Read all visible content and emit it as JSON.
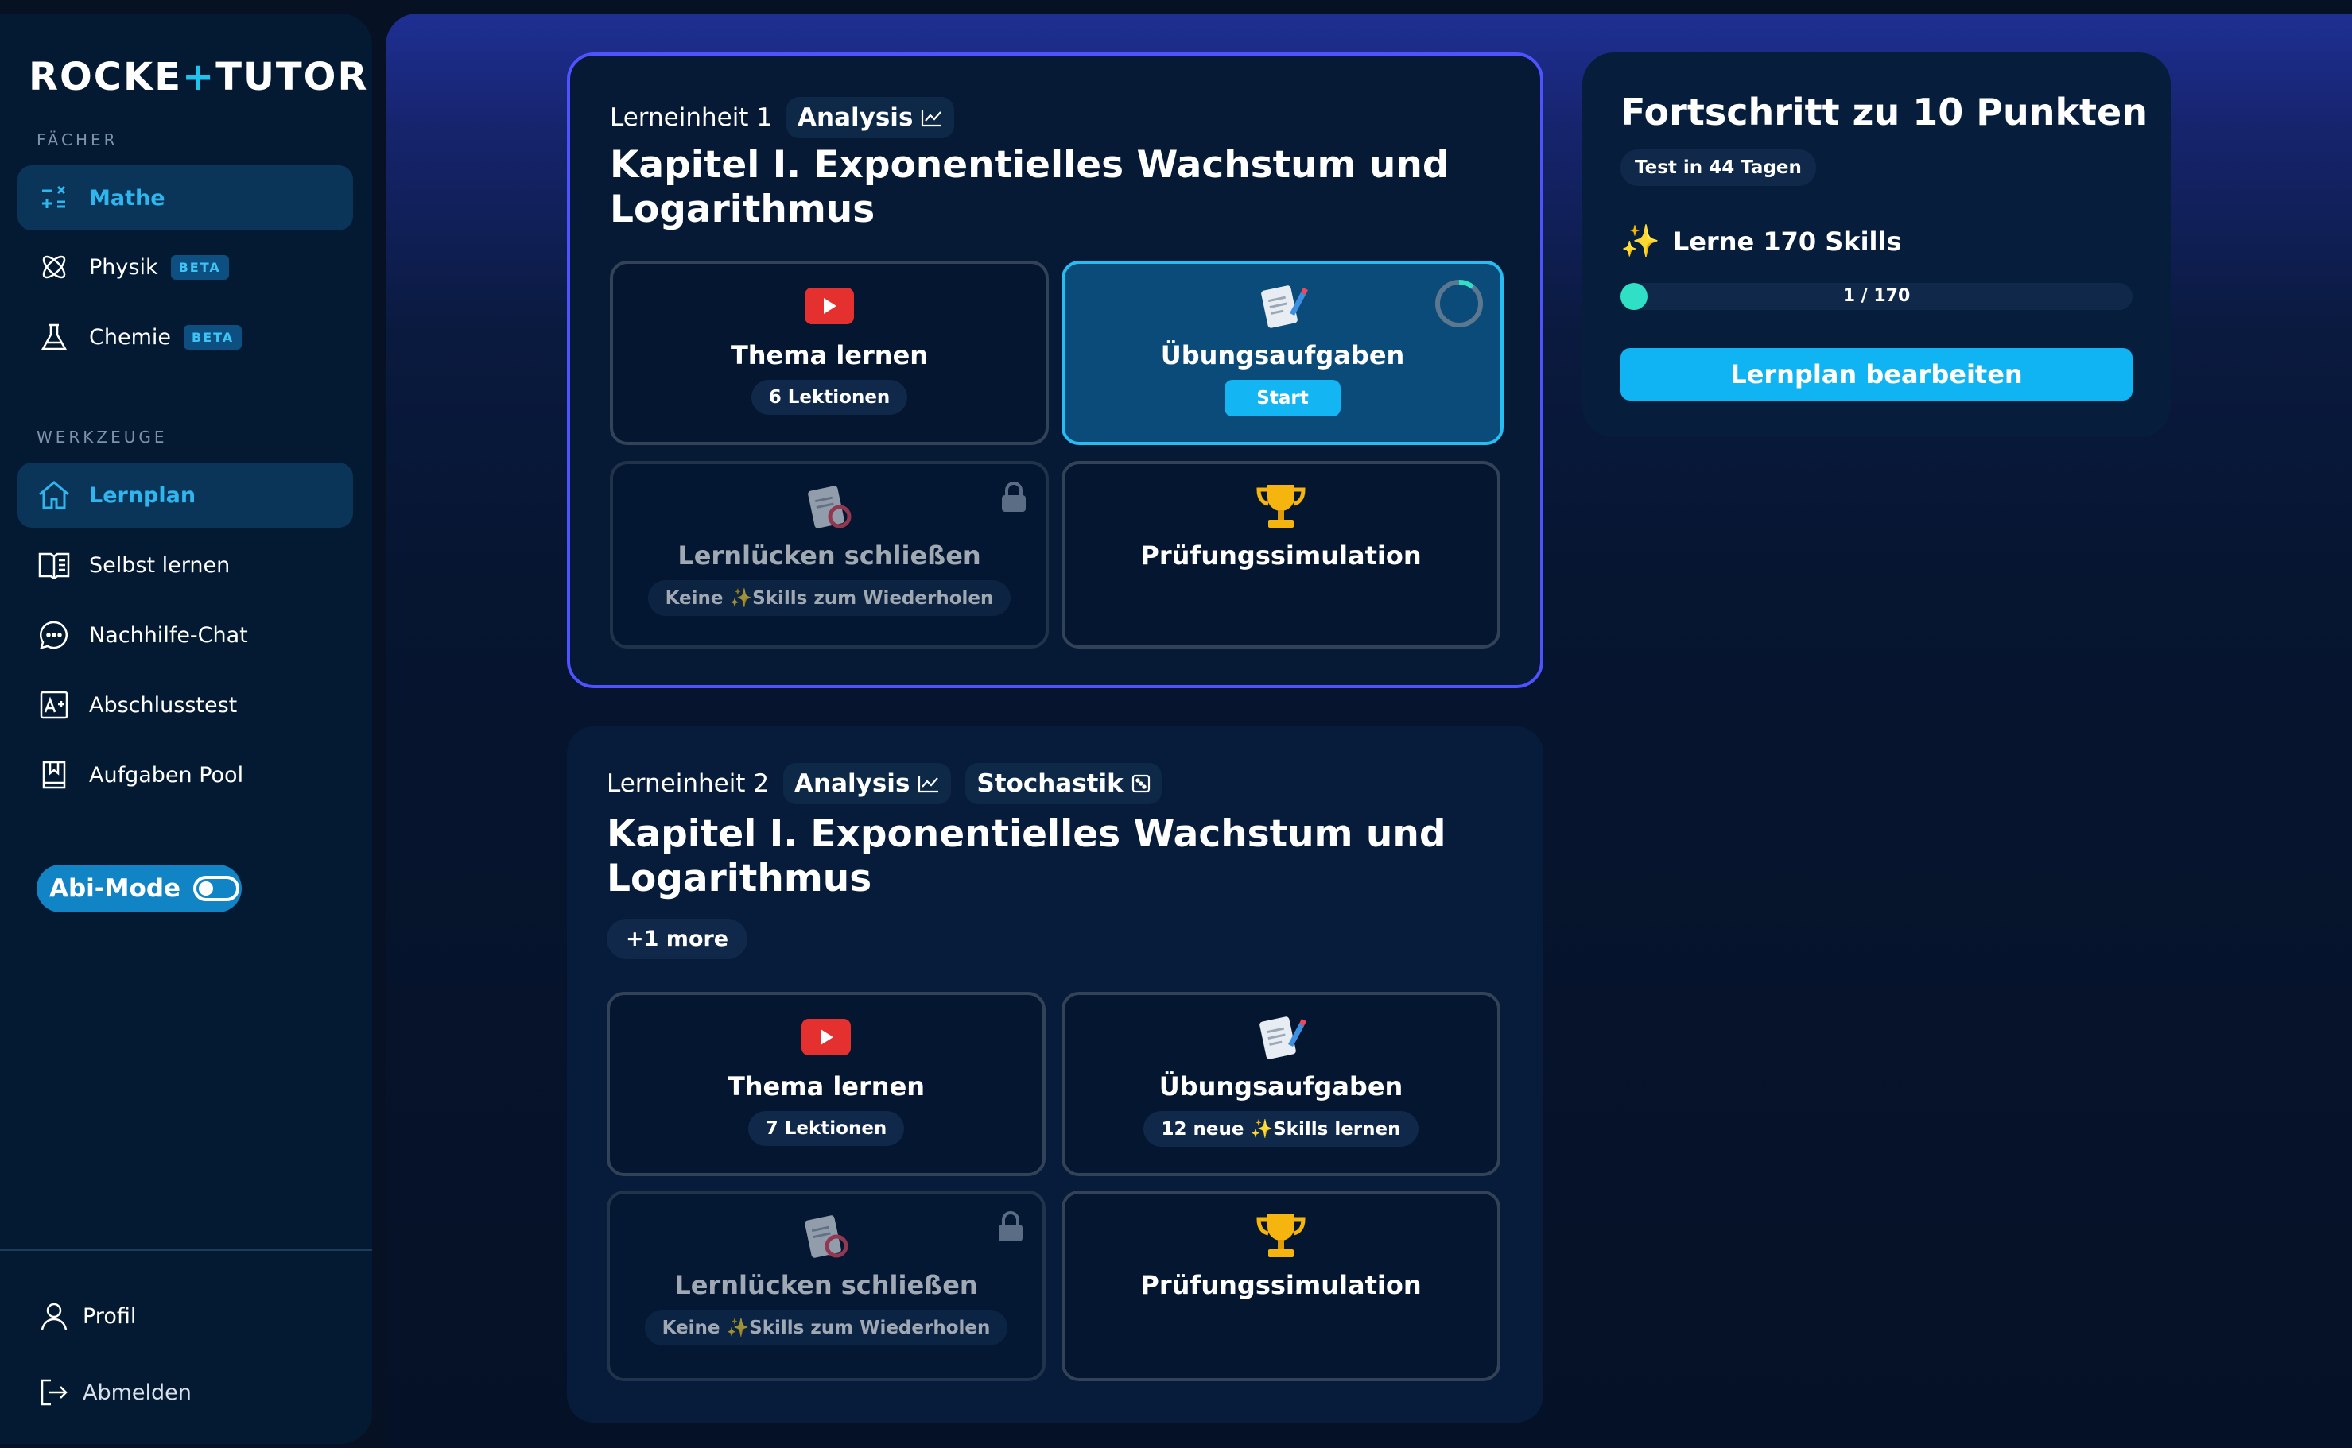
{
  "brand": {
    "logo_left": "ROCKE",
    "logo_plus": "+",
    "logo_right": "TUTOR"
  },
  "sidebar": {
    "subjects_label": "FÄCHER",
    "subjects": [
      {
        "label": "Mathe",
        "active": true
      },
      {
        "label": "Physik",
        "badge": "BETA"
      },
      {
        "label": "Chemie",
        "badge": "BETA"
      }
    ],
    "tools_label": "WERKZEUGE",
    "tools": [
      {
        "label": "Lernplan",
        "active": true
      },
      {
        "label": "Selbst lernen"
      },
      {
        "label": "Nachhilfe-Chat"
      },
      {
        "label": "Abschlusstest"
      },
      {
        "label": "Aufgaben Pool"
      }
    ],
    "abi_mode_label": "Abi-Mode",
    "profile_label": "Profil",
    "logout_label": "Abmelden"
  },
  "units": [
    {
      "unit_label": "Lerneinheit 1",
      "tags": [
        "Analysis"
      ],
      "title": "Kapitel I. Exponentielles Wachstum und Logarithmus",
      "tiles": [
        {
          "title": "Thema lernen",
          "pill": "6 Lektionen"
        },
        {
          "title": "Übungsaufgaben",
          "button": "Start"
        },
        {
          "title": "Lernlücken schließen",
          "pill_a": "Keine",
          "pill_b": "Skills zum Wiederholen"
        },
        {
          "title": "Prüfungssimulation"
        }
      ]
    },
    {
      "unit_label": "Lerneinheit 2",
      "tags": [
        "Analysis",
        "Stochastik"
      ],
      "title": "Kapitel I. Exponentielles Wachstum und Logarithmus",
      "more": "+1 more",
      "tiles": [
        {
          "title": "Thema lernen",
          "pill": "7 Lektionen"
        },
        {
          "title": "Übungsaufgaben",
          "pill_a": "12 neue",
          "pill_b": "Skills lernen"
        },
        {
          "title": "Lernlücken schließen",
          "pill_a": "Keine",
          "pill_b": "Skills zum Wiederholen"
        },
        {
          "title": "Prüfungssimulation"
        }
      ]
    }
  ],
  "progress": {
    "title": "Fortschritt zu 10 Punkten",
    "test_pill": "Test in 44 Tagen",
    "skills_label": "Lerne 170 Skills",
    "bar_text": "1 / 170",
    "current": 1,
    "total": 170,
    "button": "Lernplan bearbeiten"
  },
  "colors": {
    "accent": "#13b5f2",
    "selected_border": "#4f52ff",
    "progress_dot": "#2fe0c6"
  }
}
